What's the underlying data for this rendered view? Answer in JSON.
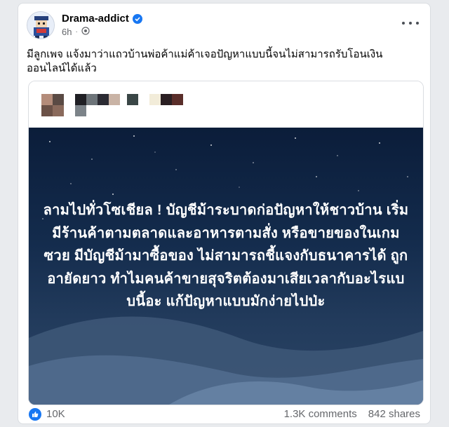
{
  "post": {
    "author": "Drama-addict",
    "time": "6h",
    "caption": "มีลูกเพจ แจ้งมาว่าแถวบ้านพ่อค้าแม่ค้าเจอปัญหาแบบนี้จนไม่สามารถรับโอนเงินออนไลน์ได้แล้ว",
    "image_headline": "ลามไปทั่วโซเชียล ! บัญชีม้าระบาดก่อปัญหาให้ชาวบ้าน เริ่มมีร้านค้าตามตลาดและอาหารตามสั่ง หรือขายของในเกมซวย มีบัญชีม้ามาซื้อของ ไม่สามารถชี้แจงกับธนาคารได้ ถูกอายัดยาว ทำไมคนค้าขายสุจริตต้องมาเสียเวลากับอะไรแบบนี้อะ แก้ปัญหาแบบมักง่ายไปป่ะ",
    "icons": {
      "verified": "verified-badge-icon",
      "privacy": "globe-icon",
      "more": "more-options-icon",
      "like": "like-reaction-icon"
    }
  },
  "reactions": {
    "count": "10K",
    "comments": "1.3K comments",
    "shares": "842 shares"
  },
  "colors": {
    "accent": "#1877f2",
    "text": "#050505",
    "secondary": "#65676b"
  }
}
